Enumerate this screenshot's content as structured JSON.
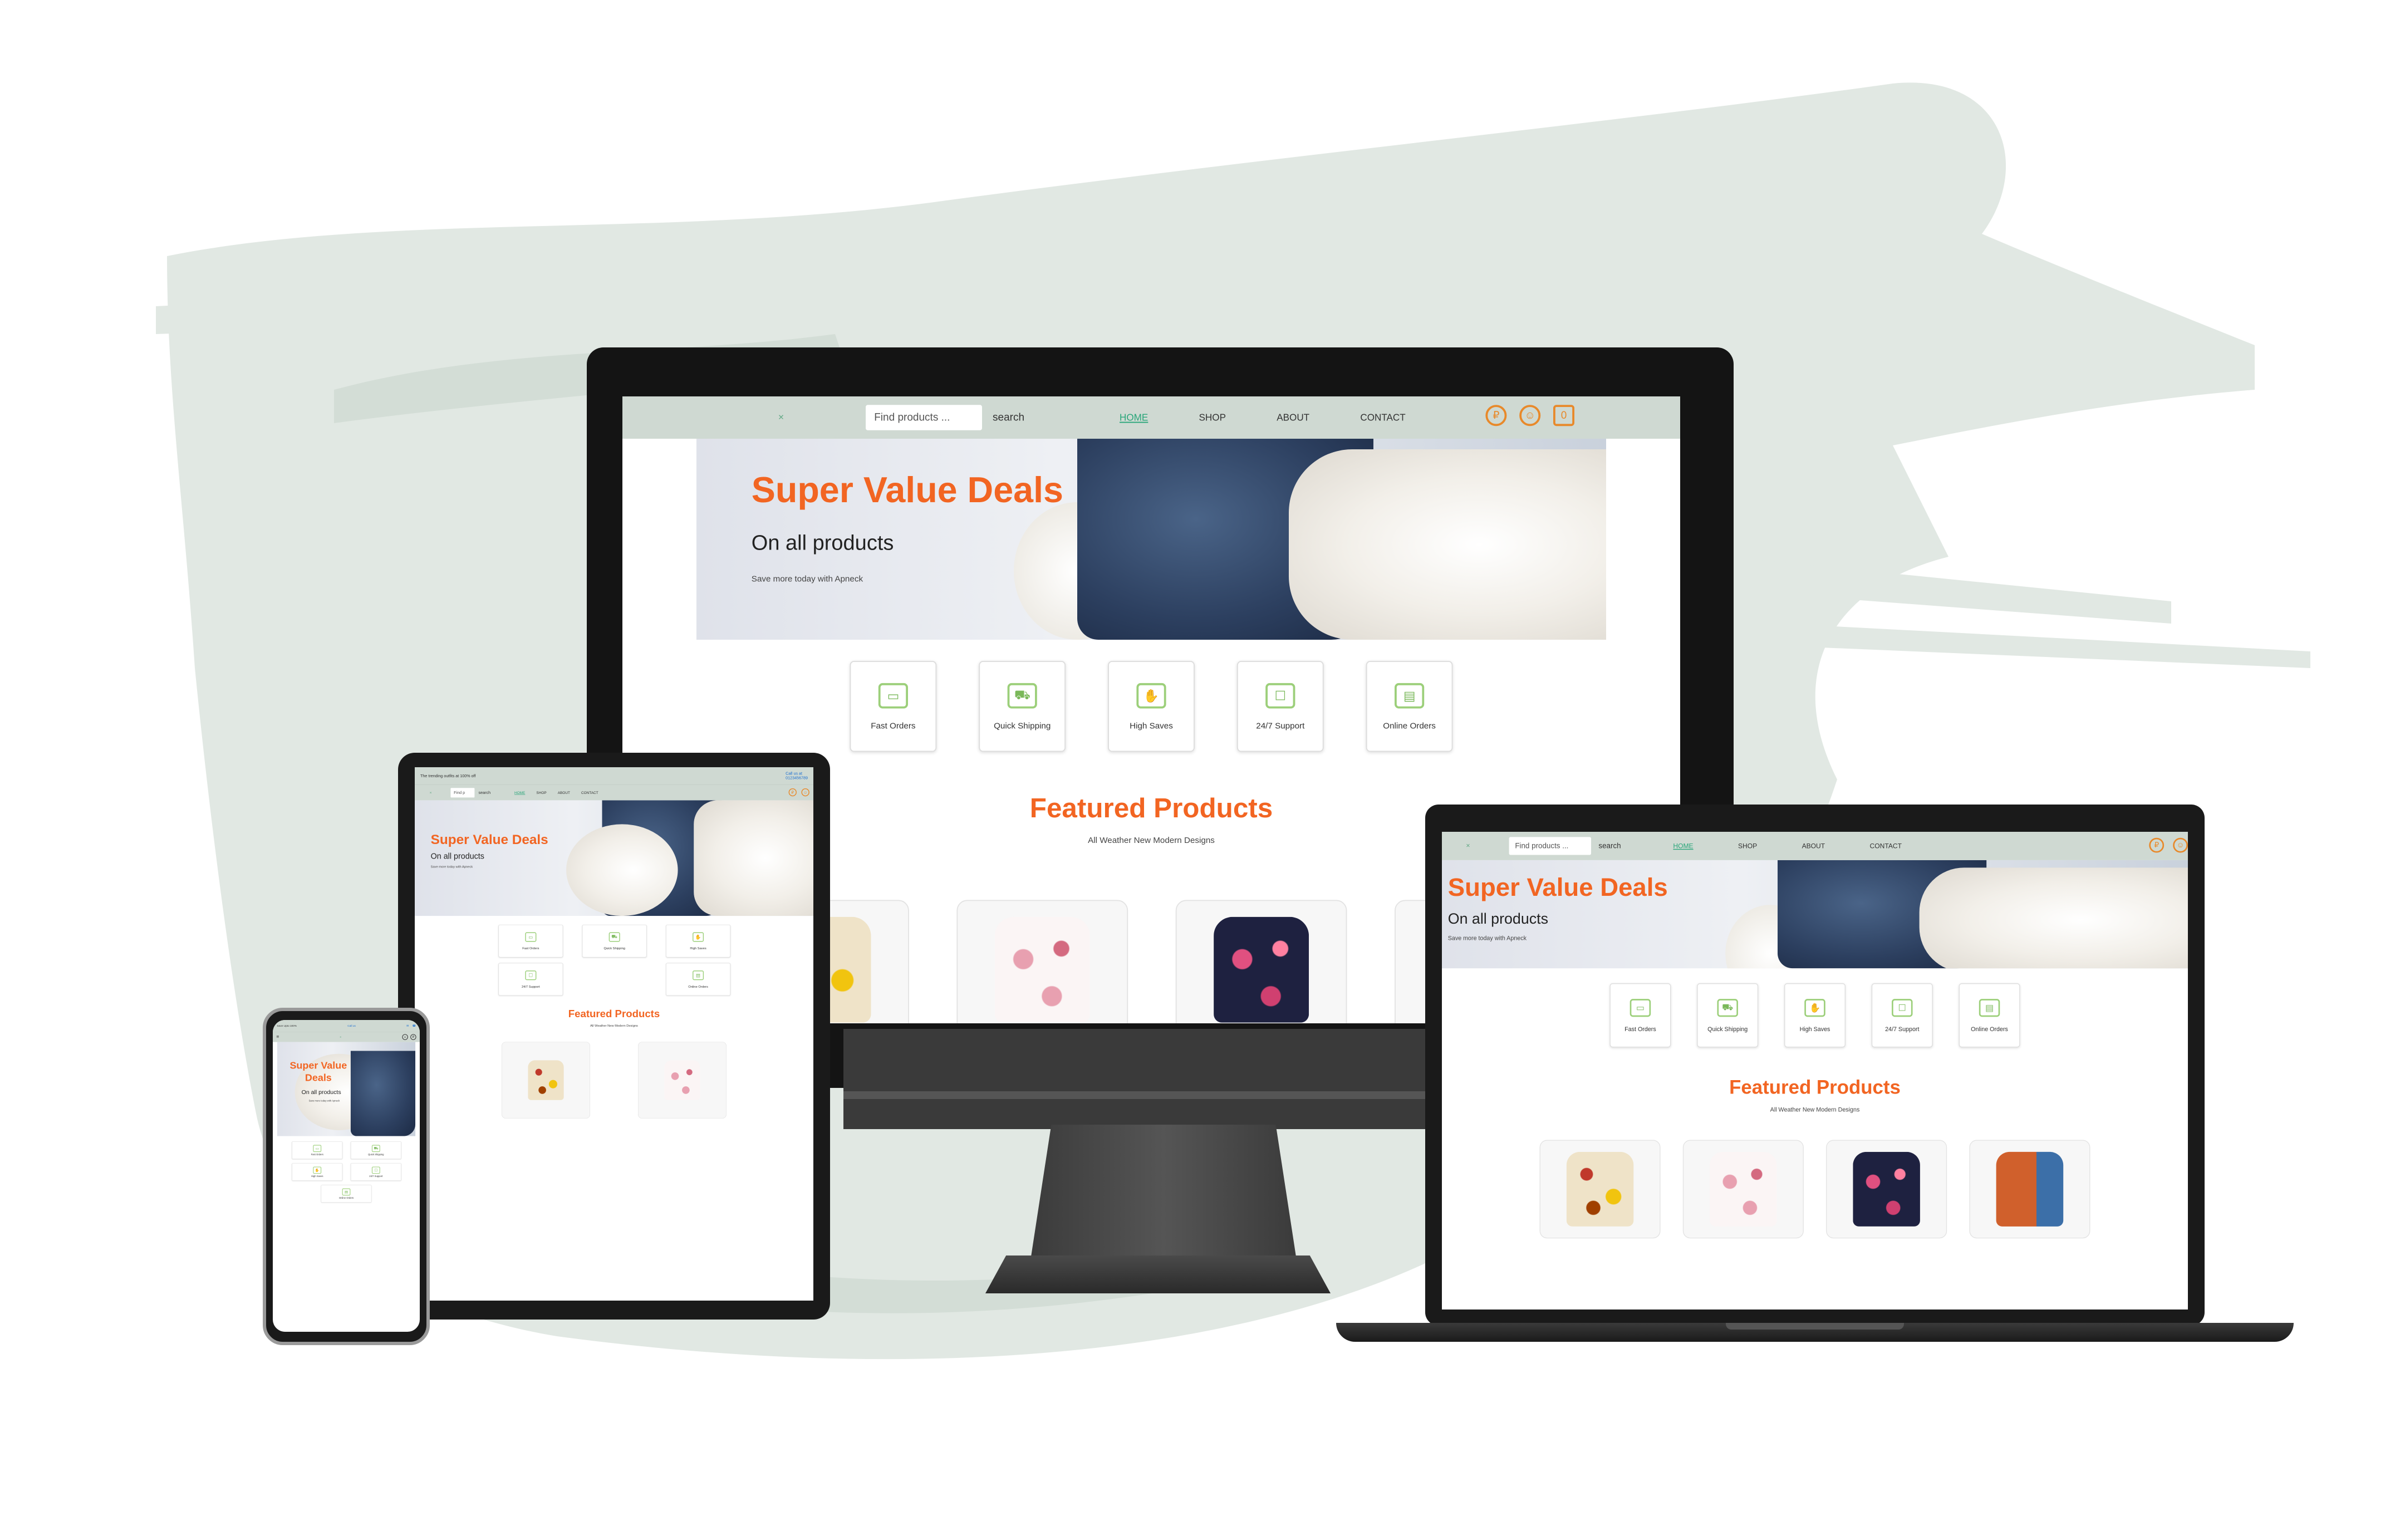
{
  "site": {
    "search_placeholder": "Find products ...",
    "search_placeholder_short": "Find p",
    "search_button": "search",
    "menu": [
      "HOME",
      "SHOP",
      "ABOUT",
      "CONTACT"
    ],
    "cart_count": "0",
    "hero": {
      "title": "Super Value Deals",
      "subtitle": "On all products",
      "note": "Save more today with Apneck"
    },
    "features": [
      "Fast Orders",
      "Quick Shipping",
      "High Saves",
      "24/7 Support",
      "Online Orders"
    ],
    "featured_title": "Featured Products",
    "featured_subtitle": "All Weather New Modern Designs",
    "tablet_topbar": {
      "promo": "The trending outfits at 100% off",
      "call_label": "Call us at",
      "phone": "0123456789"
    },
    "phone_topbar": {
      "promo": "Save Upto 100%",
      "call_label": "Call us"
    }
  },
  "colors": {
    "accent_orange": "#f26522",
    "nav_bg": "#cfd9d2",
    "active_link": "#2aa67a",
    "feature_icon": "#9ccf7a"
  }
}
